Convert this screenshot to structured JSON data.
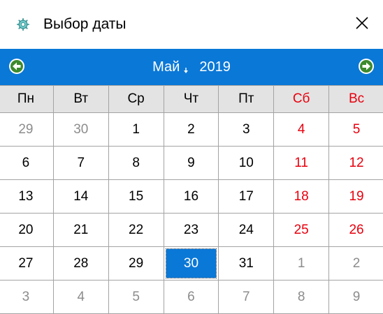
{
  "window": {
    "title": "Выбор даты",
    "close_symbol": "✕"
  },
  "icons": {
    "app": "calendar-app-icon",
    "close": "close-icon",
    "prev": "arrow-left-icon",
    "next": "arrow-right-icon",
    "dropdown": "caret-down-icon"
  },
  "colors": {
    "accent": "#0a78d7",
    "weekend": "#e8000d",
    "other_month": "#8c8c8c",
    "header_bg": "#e3e3e3"
  },
  "nav": {
    "month": "Май",
    "year": "2019"
  },
  "weekdays": [
    {
      "label": "Пн",
      "weekend": false
    },
    {
      "label": "Вт",
      "weekend": false
    },
    {
      "label": "Ср",
      "weekend": false
    },
    {
      "label": "Чт",
      "weekend": false
    },
    {
      "label": "Пт",
      "weekend": false
    },
    {
      "label": "Сб",
      "weekend": true
    },
    {
      "label": "Вс",
      "weekend": true
    }
  ],
  "weeks": [
    [
      {
        "d": "29",
        "t": "oth"
      },
      {
        "d": "30",
        "t": "oth"
      },
      {
        "d": "1",
        "t": "cur"
      },
      {
        "d": "2",
        "t": "cur"
      },
      {
        "d": "3",
        "t": "cur"
      },
      {
        "d": "4",
        "t": "wk"
      },
      {
        "d": "5",
        "t": "wk"
      }
    ],
    [
      {
        "d": "6",
        "t": "cur"
      },
      {
        "d": "7",
        "t": "cur"
      },
      {
        "d": "8",
        "t": "cur"
      },
      {
        "d": "9",
        "t": "cur"
      },
      {
        "d": "10",
        "t": "cur"
      },
      {
        "d": "11",
        "t": "wk"
      },
      {
        "d": "12",
        "t": "wk"
      }
    ],
    [
      {
        "d": "13",
        "t": "cur"
      },
      {
        "d": "14",
        "t": "cur"
      },
      {
        "d": "15",
        "t": "cur"
      },
      {
        "d": "16",
        "t": "cur"
      },
      {
        "d": "17",
        "t": "cur"
      },
      {
        "d": "18",
        "t": "wk"
      },
      {
        "d": "19",
        "t": "wk"
      }
    ],
    [
      {
        "d": "20",
        "t": "cur"
      },
      {
        "d": "21",
        "t": "cur"
      },
      {
        "d": "22",
        "t": "cur"
      },
      {
        "d": "23",
        "t": "cur"
      },
      {
        "d": "24",
        "t": "cur"
      },
      {
        "d": "25",
        "t": "wk"
      },
      {
        "d": "26",
        "t": "wk"
      }
    ],
    [
      {
        "d": "27",
        "t": "cur"
      },
      {
        "d": "28",
        "t": "cur"
      },
      {
        "d": "29",
        "t": "cur"
      },
      {
        "d": "30",
        "t": "sel"
      },
      {
        "d": "31",
        "t": "cur"
      },
      {
        "d": "1",
        "t": "oth"
      },
      {
        "d": "2",
        "t": "oth"
      }
    ],
    [
      {
        "d": "3",
        "t": "oth"
      },
      {
        "d": "4",
        "t": "oth"
      },
      {
        "d": "5",
        "t": "oth"
      },
      {
        "d": "6",
        "t": "oth"
      },
      {
        "d": "7",
        "t": "oth"
      },
      {
        "d": "8",
        "t": "oth"
      },
      {
        "d": "9",
        "t": "oth"
      }
    ]
  ]
}
